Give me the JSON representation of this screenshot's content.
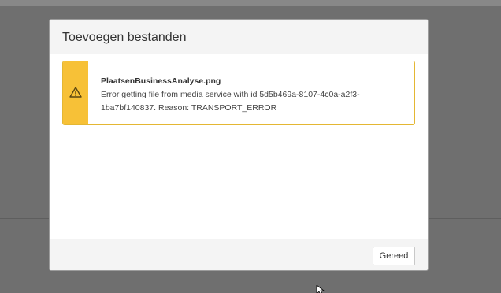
{
  "dialog": {
    "title": "Toevoegen bestanden",
    "alert": {
      "icon": "warning-icon",
      "filename": "PlaatsenBusinessAnalyse.png",
      "message": "Error getting file from media service with id 5d5b469a-8107-4c0a-a2f3-1ba7bf140837. Reason: TRANSPORT_ERROR",
      "accent_color": "#f7c137",
      "border_color": "#e4b733"
    },
    "footer": {
      "done_label": "Gereed"
    }
  },
  "colors": {
    "backdrop": "#6f6f6f",
    "header_bg": "#f4f4f4"
  }
}
